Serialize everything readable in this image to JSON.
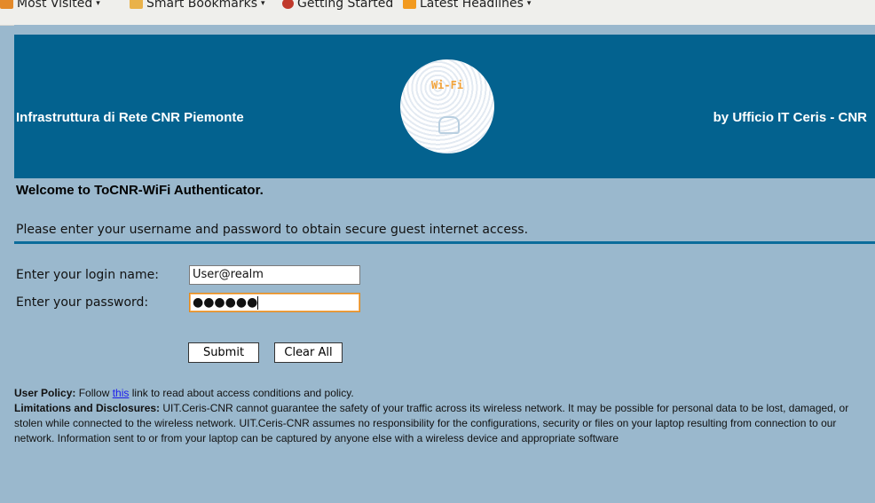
{
  "bookmarks_bar": {
    "items": [
      {
        "label": "Most Visited",
        "icon": "most-visited-icon"
      },
      {
        "label": "Smart Bookmarks",
        "icon": "smart-bookmarks-icon"
      },
      {
        "label": "Getting Started",
        "icon": "getting-started-icon"
      },
      {
        "label": "Latest Headlines",
        "icon": "rss-icon"
      }
    ],
    "arrow": "▾"
  },
  "banner": {
    "left_text": "Infrastruttura di Rete CNR Piemonte",
    "right_text": "by Ufficio IT Ceris - CNR",
    "logo_text": "Wi-Fi",
    "background_color": "#03628f"
  },
  "welcome": "Welcome to ToCNR-WiFi Authenticator.",
  "instructions": "Please enter your username and password to obtain secure guest internet access.",
  "form": {
    "login_label": "Enter your login name:",
    "login_value": "User@realm",
    "password_label": "Enter your password:",
    "password_masked": "●●●●●●",
    "submit_label": "Submit",
    "clear_label": "Clear All"
  },
  "policy": {
    "user_policy_heading": "User Policy:",
    "user_policy_pre": " Follow ",
    "user_policy_link": "this",
    "user_policy_post": " link to read about access conditions and policy.",
    "limitations_heading": "Limitations and Disclosures:",
    "limitations_text": " UIT.Ceris-CNR cannot guarantee the safety of your traffic across its wireless network. It may be possible for personal data to be lost, damaged, or stolen while connected to the wireless network. UIT.Ceris-CNR assumes no responsibility for the configurations, security or files on your laptop resulting from connection to our network. Information sent to or from your laptop can be captured by anyone else with a wireless device and appropriate software"
  },
  "colors": {
    "page_background": "#9ab8cd",
    "divider": "#0b6c9b",
    "link": "#1a1aee"
  }
}
